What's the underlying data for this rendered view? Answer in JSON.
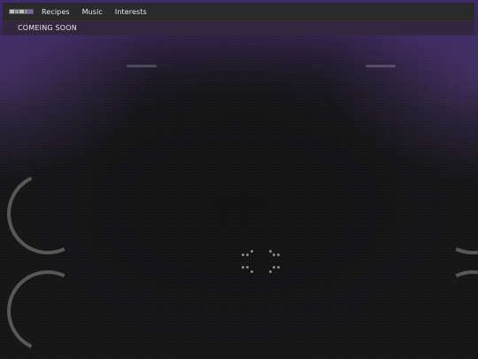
{
  "nav": {
    "logo_alt": "site logo",
    "items": [
      {
        "label": "Recipes"
      },
      {
        "label": "Music"
      },
      {
        "label": "Interests"
      }
    ]
  },
  "banner": {
    "text": "COMEING SOON"
  },
  "loader": {
    "icon": "loading-spinner-icon"
  },
  "colors": {
    "navbar_bg": "#2a2a2a",
    "accent_purple": "#3f2a66",
    "page_bg": "#151515",
    "ring": "#6e6e6e"
  }
}
